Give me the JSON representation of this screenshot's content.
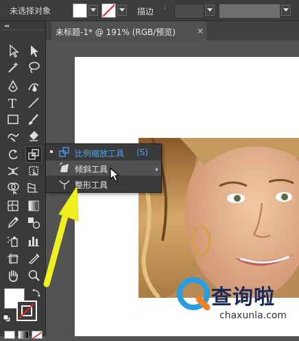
{
  "control_bar": {
    "selection_status": "未选择对象",
    "stroke_label": "描边",
    "spinner_symbol": ":"
  },
  "document": {
    "tab_title": "未标题-1* @ 191% (RGB/预览)",
    "close_symbol": "×"
  },
  "toolbar": {
    "collapse_symbol": "◂◂",
    "tools": [
      "selection-tool",
      "direct-selection-tool",
      "magic-wand-tool",
      "lasso-tool",
      "pen-tool",
      "curvature-tool",
      "type-tool",
      "line-segment-tool",
      "rectangle-tool",
      "paintbrush-tool",
      "shaper-tool",
      "eraser-tool",
      "rotate-tool",
      "scale-tool",
      "width-tool",
      "free-transform-tool",
      "shape-builder-tool",
      "perspective-grid-tool",
      "mesh-tool",
      "gradient-tool",
      "eyedropper-tool",
      "blend-tool",
      "symbol-sprayer-tool",
      "column-graph-tool",
      "artboard-tool",
      "slice-tool",
      "hand-tool",
      "zoom-tool"
    ]
  },
  "flyout": {
    "items": [
      {
        "label": "比例缩放工具",
        "shortcut": "(S)",
        "selected": true
      },
      {
        "label": "倾斜工具",
        "shortcut": "",
        "selected": false,
        "hover": true
      },
      {
        "label": "整形工具",
        "shortcut": "",
        "selected": false
      }
    ]
  },
  "watermark": {
    "text": "查询啦",
    "url": "chaxunla.com"
  },
  "colors": {
    "accent": "#4aa3ff",
    "arrow": "#f0f020",
    "ui_dark": "#3a3a3a",
    "canvas": "#535353"
  }
}
